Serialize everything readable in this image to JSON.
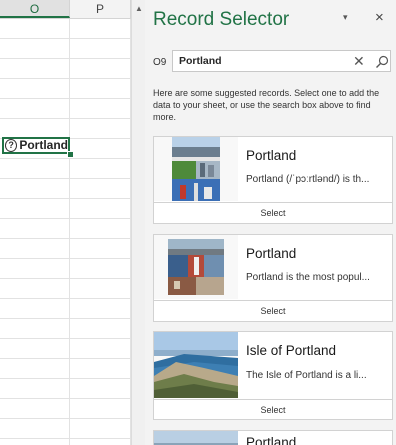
{
  "sheet": {
    "columns": [
      "O",
      "P"
    ],
    "active_cell_value": "Portland"
  },
  "pane": {
    "title": "Record Selector",
    "menu_glyph": "▾",
    "close_glyph": "×",
    "cell_ref": "O9",
    "search_value": "Portland",
    "clear_glyph": "✕",
    "intro": "Here are some suggested records. Select one to add the data to your sheet, or use the search box above to find more.",
    "records": [
      {
        "title": "Portland",
        "description": "Portland (/ˈpɔːrtlənd/) is th...",
        "select_label": "Select"
      },
      {
        "title": "Portland",
        "description": "Portland is the most popul...",
        "select_label": "Select"
      },
      {
        "title": "Isle of Portland",
        "description": "The Isle of Portland is a li...",
        "select_label": "Select"
      },
      {
        "title": "Portland",
        "description": "",
        "select_label": ""
      }
    ]
  },
  "colors": {
    "accent": "#217346",
    "pane_bg": "#f3f3f3"
  }
}
